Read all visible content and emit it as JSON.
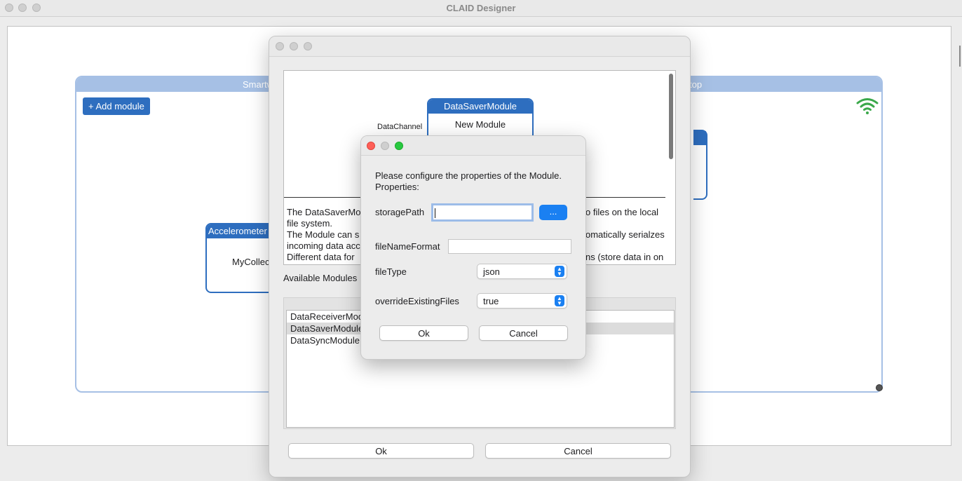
{
  "app": {
    "title": "CLAID Designer"
  },
  "canvas": {
    "device": {
      "header_left": "Smartw",
      "header_right": "top",
      "add_module_label": "+ Add module",
      "modules": [
        {
          "header": "Accelerometer",
          "body": "MyCollec"
        }
      ]
    }
  },
  "add_dialog": {
    "preview": {
      "channel_label": "DataChannel",
      "module_name": "DataSaverModule",
      "module_body": "New Module"
    },
    "description_lines_left": [
      "The DataSaverMo",
      "file system.",
      "The Module can s",
      "incoming data acc",
      "Different data for"
    ],
    "description_lines_right": [
      "o files on the local",
      "",
      "omatically serialzes",
      "",
      "ns (store data in on"
    ],
    "available_label": "Available Modules",
    "modules": [
      "DataReceiverModu",
      "DataSaverModule",
      "DataSyncModule"
    ],
    "selected_index": 1,
    "ok_label": "Ok",
    "cancel_label": "Cancel"
  },
  "props_dialog": {
    "intro": "Please configure the properties of the Module.",
    "properties_label": "Properties:",
    "storage_path": {
      "label": "storagePath",
      "value": "",
      "browse_label": "..."
    },
    "file_name_format": {
      "label": "fileNameFormat",
      "value": ""
    },
    "file_type": {
      "label": "fileType",
      "value": "json"
    },
    "override": {
      "label": "overrideExistingFiles",
      "value": "true"
    },
    "ok_label": "Ok",
    "cancel_label": "Cancel"
  },
  "colors": {
    "module_blue": "#2e6ebf",
    "device_header": "#a6c0e5",
    "accent_blue": "#1a80f2",
    "wifi_green": "#3aa84a",
    "close_red": "#fe5f57",
    "zoom_green": "#28c840"
  }
}
